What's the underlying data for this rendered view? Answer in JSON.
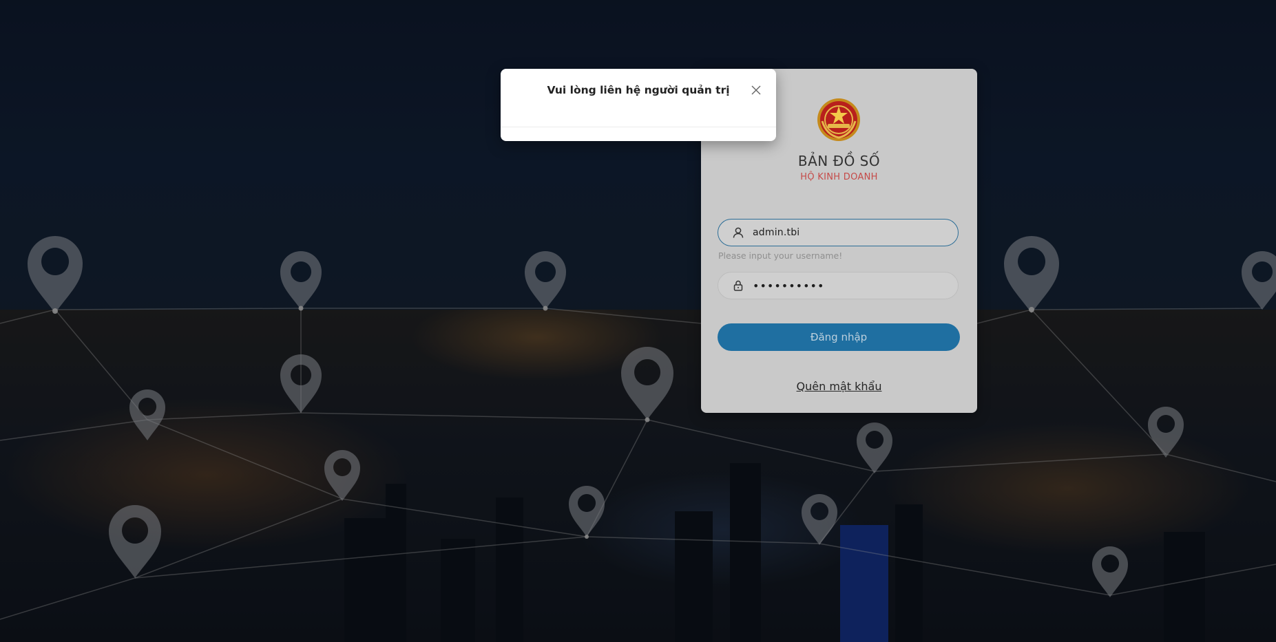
{
  "app": {
    "title": "BẢN ĐỒ SỐ",
    "subtitle": "HỘ KINH DOANH",
    "emblem_icon": "national-emblem-icon"
  },
  "login": {
    "username_value": "admin.tbi",
    "username_icon": "user-icon",
    "username_helper": "Please input your username!",
    "password_value": "••••••••••",
    "password_icon": "lock-icon",
    "submit_label": "Đăng nhập",
    "forgot_label": "Quên mật khẩu"
  },
  "modal": {
    "message": "Vui lòng liên hệ người quản trị",
    "close_icon": "close-icon"
  },
  "colors": {
    "primary": "#1f6fa1",
    "subtitle": "#c54a48",
    "card": "#c9c9c9",
    "input_focus_border": "#2b6d97"
  }
}
